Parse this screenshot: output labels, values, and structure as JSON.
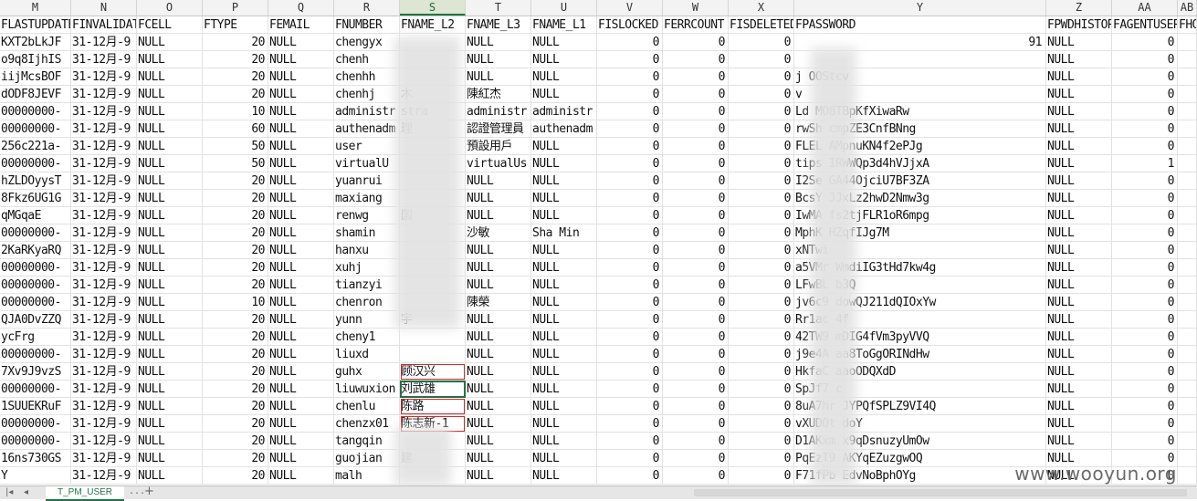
{
  "columns": [
    "M",
    "N",
    "O",
    "P",
    "Q",
    "R",
    "S",
    "T",
    "U",
    "V",
    "W",
    "X",
    "Y",
    "Z",
    "AA",
    "AB"
  ],
  "selected_column": "S",
  "header_row": [
    "FLASTUPDATE",
    "FINVALIDATE",
    "FCELL",
    "FTYPE",
    "FEMAIL",
    "FNUMBER",
    "FNAME_L2",
    "FNAME_L3",
    "FNAME_L1",
    "FISLOCKED",
    "FERRCOUNT",
    "FISDELETED",
    "FPASSWORD",
    "FPWDHISTORY",
    "FAGENTUSER",
    "FHO"
  ],
  "rows": [
    [
      "KXT2bLkJF",
      "31-12月-9",
      "NULL",
      "20",
      "NULL",
      "chengyx",
      "",
      "NULL",
      "NULL",
      "0",
      "0",
      "0",
      "91",
      "NULL",
      "0",
      ""
    ],
    [
      "o9q8IjhIS",
      "31-12月-9",
      "NULL",
      "20",
      "NULL",
      "chenh",
      "",
      "NULL",
      "NULL",
      "0",
      "0",
      "0",
      "",
      "NULL",
      "0",
      ""
    ],
    [
      "iijMcsBOF",
      "31-12月-9",
      "NULL",
      "20",
      "NULL",
      "chenhh",
      "",
      "NULL",
      "NULL",
      "0",
      "0",
      "0",
      "j         OOStcv",
      "NULL",
      "0",
      ""
    ],
    [
      "dODF8JEVF",
      "31-12月-9",
      "NULL",
      "20",
      "NULL",
      "chenhj",
      "      木",
      "陳紅杰",
      "NULL",
      "0",
      "0",
      "0",
      "v",
      "NULL",
      "0",
      ""
    ],
    [
      "00000000-",
      "31-12月-9",
      "NULL",
      "10",
      "NULL",
      "administr",
      "       stra",
      "administr",
      "administr",
      "0",
      "0",
      "0",
      "Ld       MO8TBpKfXiwaRw",
      "NULL",
      "0",
      ""
    ],
    [
      "00000000-",
      "31-12月-9",
      "NULL",
      "60",
      "NULL",
      "authenadm",
      "        理",
      "認證管理員",
      "authenadm",
      "0",
      "0",
      "0",
      "rwSh      cmpZE3CnfBNng",
      "NULL",
      "0",
      ""
    ],
    [
      "256c221a-",
      "31-12月-9",
      "NULL",
      "50",
      "NULL",
      "user",
      "",
      "預設用戶",
      "NULL",
      "0",
      "0",
      "0",
      "FLEL      AMpnuKN4f2ePJg",
      "NULL",
      "0",
      ""
    ],
    [
      "00000000-",
      "31-12月-9",
      "NULL",
      "50",
      "NULL",
      "virtualU",
      "",
      "virtualUs",
      "NULL",
      "0",
      "0",
      "0",
      "tips      IRWWQp3d4hVJjxA",
      "NULL",
      "1",
      ""
    ],
    [
      "hZLDOyysT",
      "31-12月-9",
      "NULL",
      "20",
      "NULL",
      "yuanrui",
      "",
      "NULL",
      "NULL",
      "0",
      "0",
      "0",
      "I2Se      GA44OjciU7BF3ZA",
      "NULL",
      "0",
      ""
    ],
    [
      "8Fkz6UG1G",
      "31-12月-9",
      "NULL",
      "20",
      "NULL",
      "maxiang",
      "",
      "NULL",
      "NULL",
      "0",
      "0",
      "0",
      "BcsY      JJxLz2hwD2Nmw3g",
      "NULL",
      "0",
      ""
    ],
    [
      "qMGqaE",
      "31-12月-9",
      "NULL",
      "20",
      "NULL",
      "renwg",
      "      国",
      "NULL",
      "NULL",
      "0",
      "0",
      "0",
      "IwMA      fs2tjFLR1oR6mpg",
      "NULL",
      "0",
      ""
    ],
    [
      "00000000-",
      "31-12月-9",
      "NULL",
      "20",
      "NULL",
      "shamin",
      "",
      "沙敏",
      "Sha Min",
      "0",
      "0",
      "0",
      "MphK      HZqfIJg7M",
      "NULL",
      "0",
      ""
    ],
    [
      "2KaRKyaRQ",
      "31-12月-9",
      "NULL",
      "20",
      "NULL",
      "hanxu",
      "",
      "NULL",
      "NULL",
      "0",
      "0",
      "0",
      "xNTwi",
      "NULL",
      "0",
      ""
    ],
    [
      "00000000-",
      "31-12月-9",
      "NULL",
      "20",
      "NULL",
      "xuhj",
      "",
      "NULL",
      "NULL",
      "0",
      "0",
      "0",
      "a5VMr     WmdiIG3tHd7kw4g",
      "NULL",
      "0",
      ""
    ],
    [
      "00000000-",
      "31-12月-9",
      "NULL",
      "20",
      "NULL",
      "tianzyi",
      "",
      "NULL",
      "NULL",
      "0",
      "0",
      "0",
      "LFwBL    b3Q",
      "NULL",
      "0",
      ""
    ],
    [
      "00000000-",
      "31-12月-9",
      "NULL",
      "10",
      "NULL",
      "chenron",
      "",
      "陳榮",
      "NULL",
      "0",
      "0",
      "0",
      "jv6c9     dowQJ211dQIOxYw",
      "NULL",
      "0",
      ""
    ],
    [
      "QJA0DvZZQ",
      "31-12月-9",
      "NULL",
      "20",
      "NULL",
      "yunn",
      "      宇",
      "NULL",
      "NULL",
      "0",
      "0",
      "0",
      "Rr1ac     4f",
      "NULL",
      "0",
      ""
    ],
    [
      "ycFrg",
      "31-12月-9",
      "NULL",
      "20",
      "NULL",
      "cheny1",
      "",
      "NULL",
      "NULL",
      "0",
      "0",
      "0",
      "42TW9     mDIG4fVm3pyVVQ",
      "NULL",
      "0",
      ""
    ],
    [
      "00000000-",
      "31-12月-9",
      "NULL",
      "20",
      "NULL",
      "liuxd",
      "",
      "NULL",
      "NULL",
      "0",
      "0",
      "0",
      "j9e4A     aa8ToGgORINdHw",
      "NULL",
      "0",
      ""
    ],
    [
      "7Xv9J9vzS",
      "31-12月-9",
      "NULL",
      "20",
      "NULL",
      "guhx",
      "顾汉兴",
      "NULL",
      "NULL",
      "0",
      "0",
      "0",
      "HkfaC     aaoODQXdD",
      "NULL",
      "0",
      ""
    ],
    [
      "00000000-",
      "31-12月-9",
      "NULL",
      "20",
      "NULL",
      "liuwuxion",
      "刘武雄",
      "NULL",
      "NULL",
      "0",
      "0",
      "0",
      "SpJf7     c",
      "NULL",
      "0",
      ""
    ],
    [
      "1SUUEKRuF",
      "31-12月-9",
      "NULL",
      "20",
      "NULL",
      "chenlu",
      "陈路",
      "NULL",
      "NULL",
      "0",
      "0",
      "0",
      "8uA7hr    JYPQfSPLZ9VI4Q",
      "NULL",
      "0",
      ""
    ],
    [
      "00000000-",
      "31-12月-9",
      "NULL",
      "20",
      "NULL",
      "chenzx01",
      "陈志新-1",
      "NULL",
      "NULL",
      "0",
      "0",
      "0",
      "vXUDQt    doY",
      "NULL",
      "0",
      ""
    ],
    [
      "00000000-",
      "31-12月-9",
      "NULL",
      "20",
      "NULL",
      "tangqin",
      "",
      "NULL",
      "NULL",
      "0",
      "0",
      "0",
      "D1AKxm    x9qDsnuzyUmOw",
      "NULL",
      "0",
      ""
    ],
    [
      "16ns730GS",
      "31-12月-9",
      "NULL",
      "20",
      "NULL",
      "guojian",
      "      建",
      "NULL",
      "NULL",
      "0",
      "0",
      "0",
      "PqEzT9    AKYqEZuzgwOQ",
      "NULL",
      "0",
      ""
    ],
    [
      "Y",
      "31-12月-9",
      "NULL",
      "20",
      "NULL",
      "malh",
      "",
      "NULL",
      "NULL",
      "0",
      "0",
      "0",
      "F71fPb    EdvNoBphOYg",
      "NULL",
      "0",
      ""
    ]
  ],
  "sheet_tab": "T_PM_USER",
  "tab_nav": {
    "first": "|◂",
    "prev": "◂",
    "dots": "...",
    "add": "+"
  },
  "watermark": "www.wooyun.org",
  "colors": {
    "header_bg": "#f3f3f3",
    "accent": "#217346",
    "highlight_red": "#d62828"
  }
}
